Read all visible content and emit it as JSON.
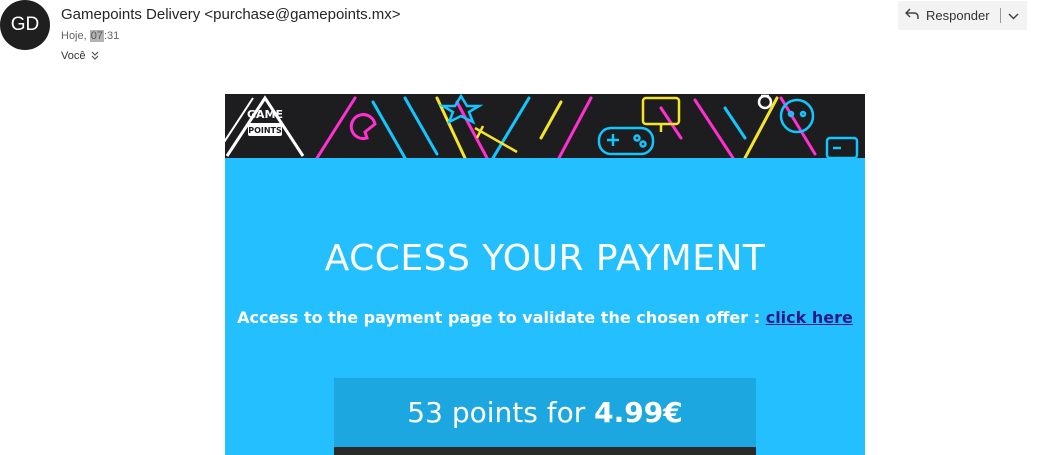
{
  "header": {
    "avatar_initials": "GD",
    "sender": "Gamepoints Delivery <purchase@gamepoints.mx>",
    "date_prefix": "Hoje, ",
    "time_hour": "07",
    "time_rest": ":31",
    "recipient": "Você",
    "reply_label": "Responder"
  },
  "banner": {
    "logo_line1": "GAME",
    "logo_line2": "POINTS",
    "colors": {
      "bg": "#1d1d1f",
      "pink": "#ff2fd0",
      "cyan": "#12c6ff",
      "yellow": "#f5e52a",
      "white": "#ffffff"
    }
  },
  "email": {
    "headline": "ACCESS YOUR PAYMENT",
    "subline_text": "Access to the payment page to validate the chosen offer : ",
    "link_text": "click here",
    "offer_prefix": "53 points for ",
    "offer_price": "4.99€",
    "colors": {
      "panel": "#23bfff",
      "offer_box": "#1da7e0",
      "link": "#2b1a86"
    }
  }
}
